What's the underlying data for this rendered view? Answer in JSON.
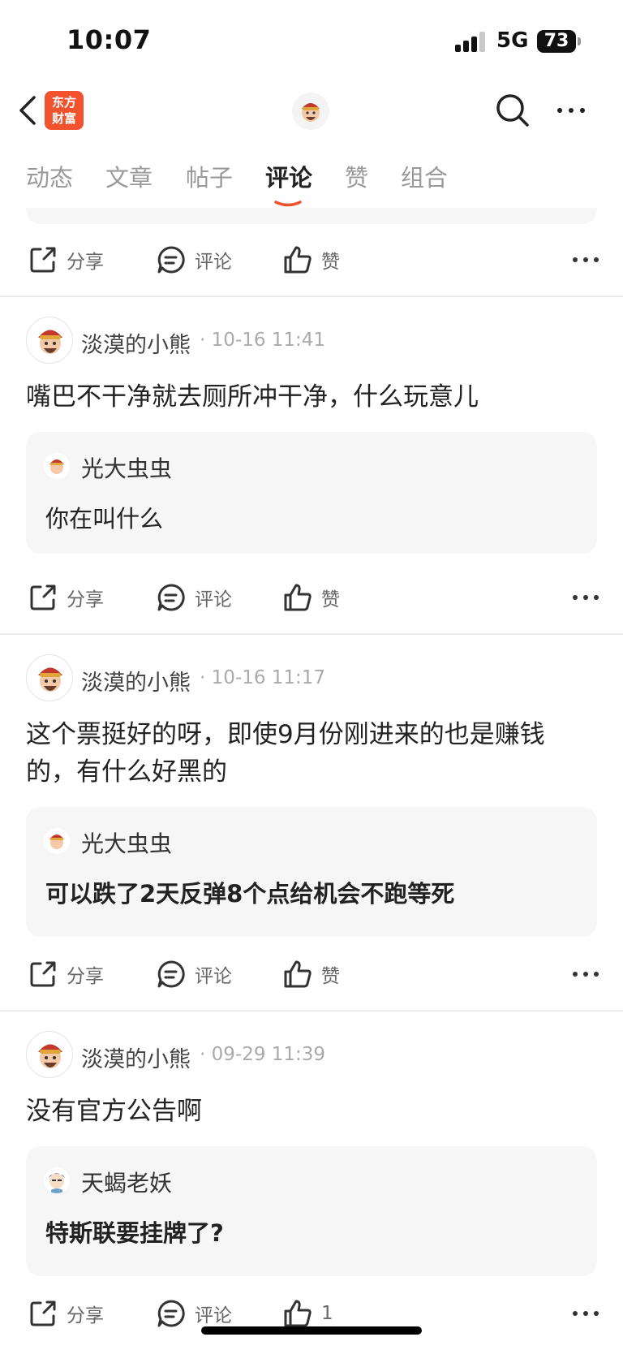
{
  "status_bar": {
    "time": "10:07",
    "network": "5G",
    "battery": "73"
  },
  "nav": {
    "logo_line1": "东方",
    "logo_line2": "财富"
  },
  "tabs": [
    "动态",
    "文章",
    "帖子",
    "评论",
    "赞",
    "组合"
  ],
  "active_tab": "评论",
  "actions": {
    "share": "分享",
    "comment": "评论",
    "like": "赞"
  },
  "posts": [
    {
      "author": "淡漠的小熊",
      "time": "10-16 11:41",
      "text": "嘴巴不干净就去厕所冲干净，什么玩意儿",
      "quote": {
        "author": "光大虫虫",
        "text": "你在叫什么"
      },
      "like_label": "赞"
    },
    {
      "author": "淡漠的小熊",
      "time": "10-16 11:17",
      "text_line1": "这个票挺好的呀，即使9月份刚进来的也是赚钱",
      "text_line2": "的，有什么好黑的",
      "quote": {
        "author": "光大虫虫",
        "text": "可以跌了2天反弹8个点给机会不跑等死"
      },
      "like_label": "赞"
    },
    {
      "author": "淡漠的小熊",
      "time": "09-29 11:39",
      "text": "没有官方公告啊",
      "quote": {
        "author": "天蝎老妖",
        "text": "特斯联要挂牌了?"
      },
      "like_label": "1"
    }
  ],
  "colors": {
    "accent": "#f2522e",
    "quote_bg": "#f6f6f7",
    "muted": "#999999"
  }
}
